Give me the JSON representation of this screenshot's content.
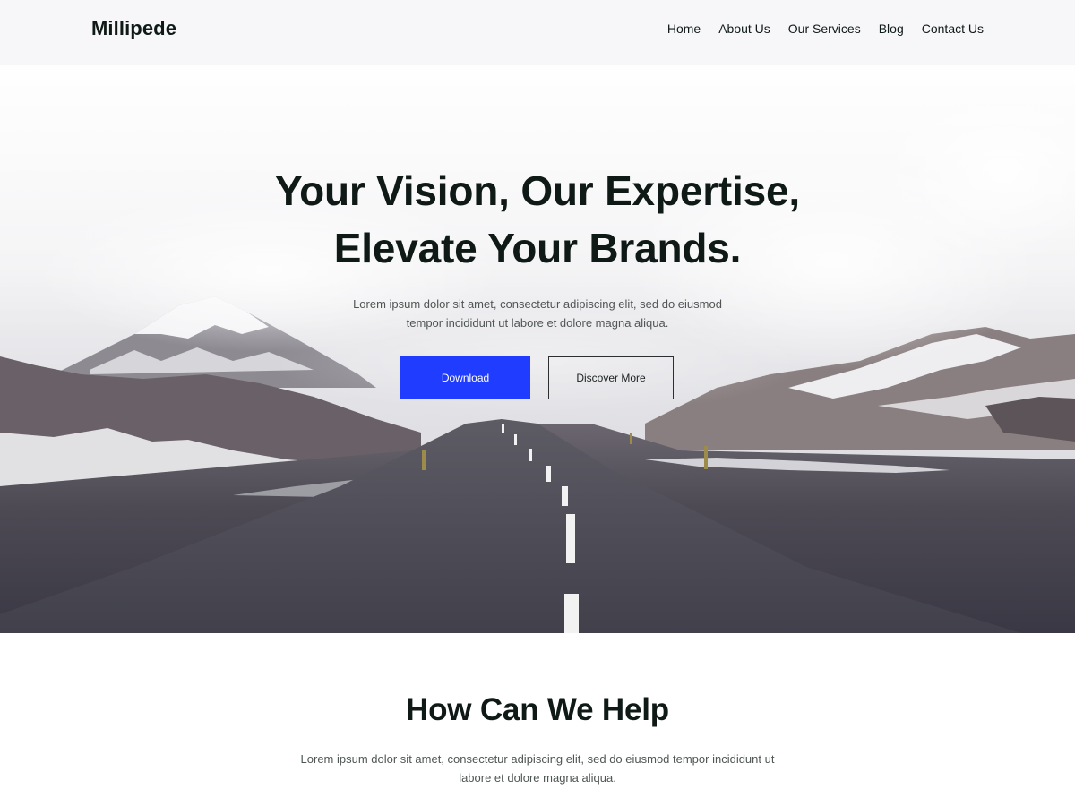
{
  "header": {
    "logo": "Millipede",
    "nav": [
      "Home",
      "About Us",
      "Our Services",
      "Blog",
      "Contact Us"
    ]
  },
  "hero": {
    "title_line1": "Your Vision, Our Expertise,",
    "title_line2": "Elevate Your Brands.",
    "subtitle": "Lorem ipsum dolor sit amet, consectetur adipiscing elit, sed do eiusmod tempor incididunt ut labore et dolore magna aliqua.",
    "primary_button": "Download",
    "secondary_button": "Discover More"
  },
  "help": {
    "title": "How Can We Help",
    "subtitle": "Lorem ipsum dolor sit amet, consectetur adipiscing elit, sed do eiusmod tempor incididunt ut labore et dolore magna aliqua."
  },
  "colors": {
    "accent": "#1f3cff",
    "text_dark": "#0f1a17",
    "text_muted": "#4f5654",
    "header_bg": "#f7f7f9"
  }
}
